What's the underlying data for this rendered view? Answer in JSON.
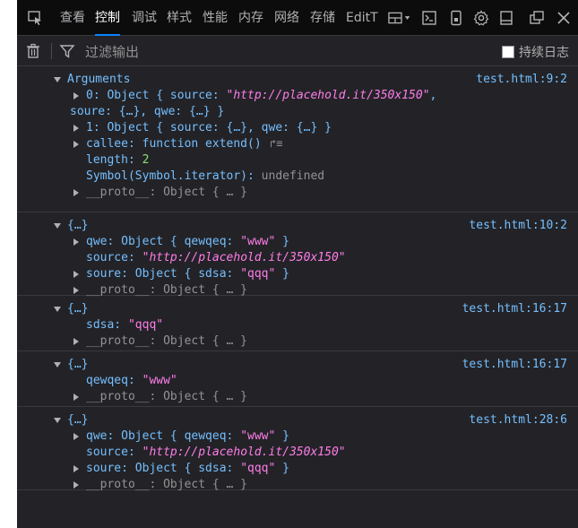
{
  "toolbar": {
    "tabs": [
      "查看",
      "控制",
      "调试",
      "样式",
      "性能",
      "内存",
      "网络",
      "存储",
      "EditT"
    ],
    "active_tab": "控制"
  },
  "filterbar": {
    "placeholder": "过滤输出",
    "persist_label": "持续日志"
  },
  "console": {
    "entries": [
      {
        "source": "test.html:9:2",
        "lines": {
          "header": "Arguments",
          "l1a": "0: Object { source: ",
          "l1b": "\"http://placehold.it/350x150\"",
          "l1c": ",",
          "l2": "soure: {…}, qwe: {…} }",
          "l3": "1: Object { source: {…}, qwe: {…} }",
          "l4a": "callee: function extend()",
          "l5a": "length: ",
          "l5b": "2",
          "l6a": "Symbol(Symbol.iterator): ",
          "l6b": "undefined",
          "l7": "__proto__: Object { … }"
        }
      },
      {
        "source": "test.html:10:2",
        "lines": {
          "header": "{…}",
          "l1a": "qwe: Object { qewqeq: ",
          "l1b": "\"www\"",
          "l1c": " }",
          "l2a": "source: ",
          "l2b": "\"http://placehold.it/350x150\"",
          "l3a": "soure: Object { sdsa: ",
          "l3b": "\"qqq\"",
          "l3c": " }",
          "l4": "__proto__: Object { … }"
        }
      },
      {
        "source": "test.html:16:17",
        "lines": {
          "header": "{…}",
          "l1a": "sdsa: ",
          "l1b": "\"qqq\"",
          "l2": "__proto__: Object { … }"
        }
      },
      {
        "source": "test.html:16:17",
        "lines": {
          "header": "{…}",
          "l1a": "qewqeq: ",
          "l1b": "\"www\"",
          "l2": "__proto__: Object { … }"
        }
      },
      {
        "source": "test.html:28:6",
        "lines": {
          "header": "{…}",
          "l1a": "qwe: Object { qewqeq: ",
          "l1b": "\"www\"",
          "l1c": " }",
          "l2a": "source: ",
          "l2b": "\"http://placehold.it/350x150\"",
          "l3a": "soure: Object { sdsa: ",
          "l3b": "\"qqq\"",
          "l3c": " }",
          "l4": "__proto__: Object { … }"
        }
      }
    ]
  }
}
